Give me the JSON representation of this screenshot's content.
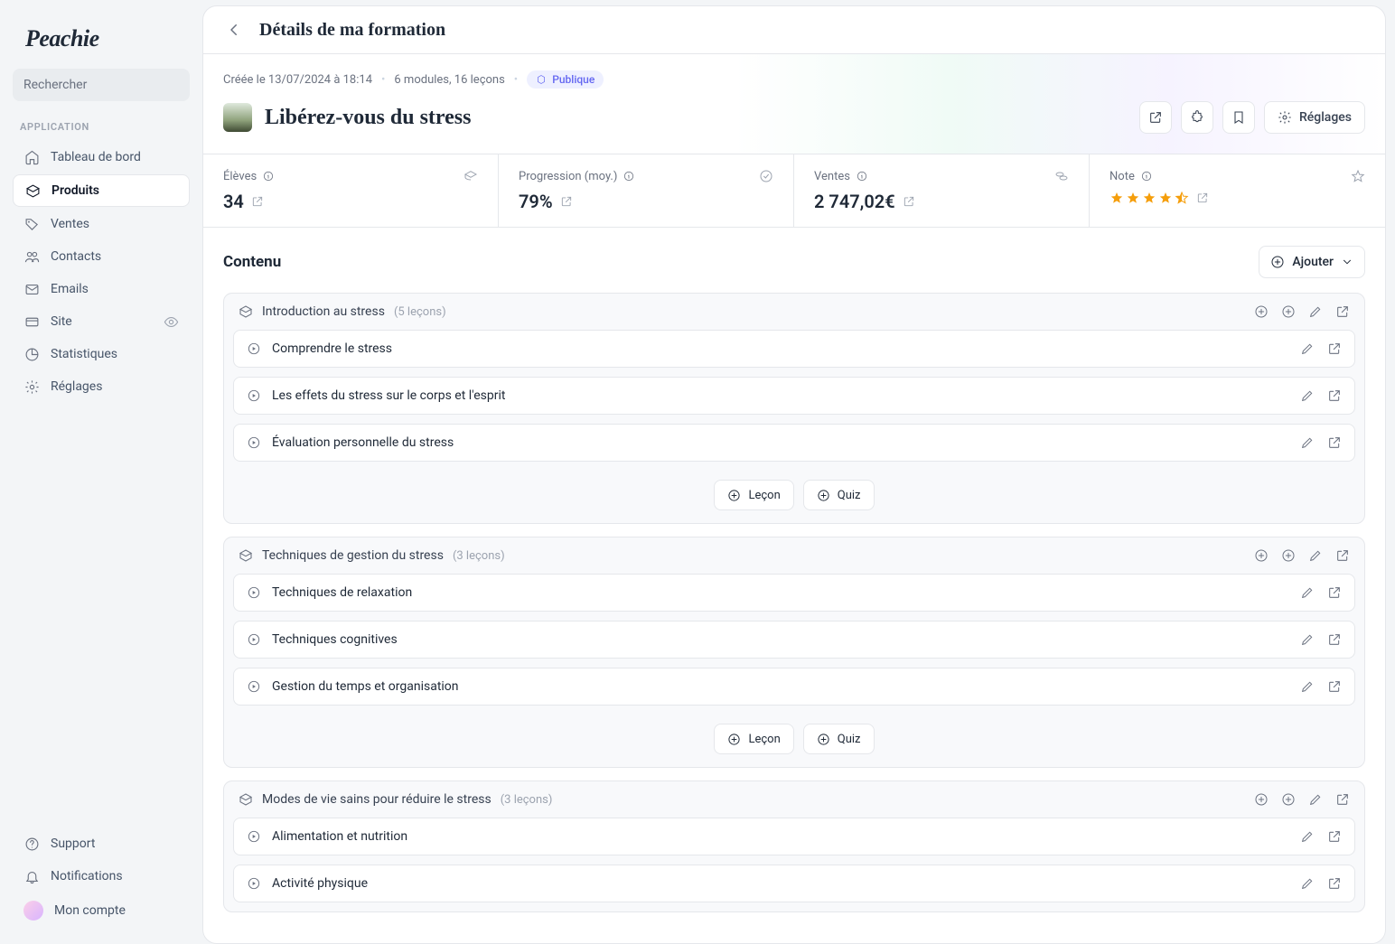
{
  "brand": "Peachie",
  "search": {
    "placeholder": "Rechercher"
  },
  "sidebar": {
    "heading": "APPLICATION",
    "items": [
      {
        "label": "Tableau de bord",
        "icon": "home"
      },
      {
        "label": "Produits",
        "icon": "box",
        "active": true
      },
      {
        "label": "Ventes",
        "icon": "tag"
      },
      {
        "label": "Contacts",
        "icon": "users"
      },
      {
        "label": "Emails",
        "icon": "mail"
      },
      {
        "label": "Site",
        "icon": "card",
        "trail": "eye"
      },
      {
        "label": "Statistiques",
        "icon": "chart"
      },
      {
        "label": "Réglages",
        "icon": "gear"
      }
    ],
    "footer": [
      {
        "label": "Support",
        "icon": "help"
      },
      {
        "label": "Notifications",
        "icon": "bell"
      },
      {
        "label": "Mon compte",
        "icon": "avatar"
      }
    ]
  },
  "page": {
    "title": "Détails de ma formation",
    "created": "Créée le 13/07/2024 à 18:14",
    "summary": "6 modules, 16 leçons",
    "status": "Publique",
    "course_title": "Libérez-vous du stress",
    "settings_btn": "Réglages"
  },
  "stats": [
    {
      "label": "Élèves",
      "value": "34",
      "corner": "grad"
    },
    {
      "label": "Progression (moy.)",
      "value": "79%",
      "corner": "check"
    },
    {
      "label": "Ventes",
      "value": "2 747,02€",
      "corner": "coins"
    },
    {
      "label": "Note",
      "value": "stars",
      "corner": "star"
    }
  ],
  "content": {
    "title": "Contenu",
    "add_btn": "Ajouter",
    "add_lesson": "Leçon",
    "add_quiz": "Quiz",
    "modules": [
      {
        "title": "Introduction au stress",
        "count": "(5 leçons)",
        "lessons": [
          "Comprendre le stress",
          "Les effets du stress sur le corps et l'esprit",
          "Évaluation personnelle du stress"
        ],
        "show_footer": true
      },
      {
        "title": "Techniques de gestion du stress",
        "count": "(3 leçons)",
        "lessons": [
          "Techniques de relaxation",
          "Techniques cognitives",
          "Gestion du temps et organisation"
        ],
        "show_footer": true
      },
      {
        "title": "Modes de vie sains pour réduire le stress",
        "count": "(3 leçons)",
        "lessons": [
          "Alimentation et nutrition",
          "Activité physique"
        ],
        "show_footer": false
      }
    ]
  }
}
